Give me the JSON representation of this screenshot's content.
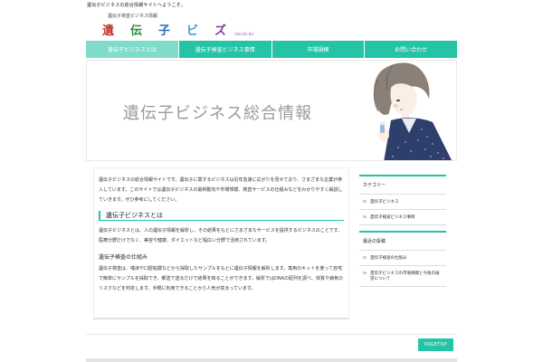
{
  "header": {
    "topline": "遺伝子ビジネスの総合情報サイトへようこそ。",
    "logo": {
      "tagline": "遺伝子検査ビジネス情報",
      "chars": [
        "遺",
        "伝",
        "子",
        "ビ",
        "ズ"
      ],
      "char_colors": [
        "#c0392b",
        "#2f8a3a",
        "#2c6fb0",
        "#3a9bd8",
        "#7b3fa0"
      ],
      "url": "idenshi.biz"
    }
  },
  "nav": {
    "items": [
      {
        "label": "遺伝子ビジネスとは"
      },
      {
        "label": "遺伝子検査ビジネス事情"
      },
      {
        "label": "市場規模"
      },
      {
        "label": "お問い合わせ"
      }
    ]
  },
  "hero": {
    "title": "遺伝子ビジネス総合情報"
  },
  "main": {
    "intro": "遺伝子ビジネスの総合情報サイトです。遺伝子に関するビジネスは近年急速に広がりを見せており、さまざまな企業が参入しています。このサイトでは遺伝子ビジネスの最新動向や市場規模、検査サービスの仕組みなどをわかりやすく解説していきます。ぜひ参考にしてください。",
    "h2": "遺伝子ビジネスとは",
    "para2": "遺伝子ビジネスとは、人の遺伝子情報を解析し、その結果をもとにさまざまなサービスを提供するビジネスのことです。医療分野だけでなく、美容や健康、ダイエットなど幅広い分野で活用されています。",
    "h3": "遺伝子検査の仕組み",
    "para3": "遺伝子検査は、唾液や口腔粘膜などから採取したサンプルをもとに遺伝子情報を解析します。専用のキットを使って自宅で簡単にサンプルを採取でき、郵送で送るだけで結果を知ることができます。解析ではDNAの配列を調べ、体質や病気のリスクなどを判定します。手軽に利用できることから人気が高まっています。"
  },
  "sidebar": {
    "widgets": [
      {
        "title": "カテゴリー",
        "items": [
          "遺伝子ビジネス",
          "遺伝子検査ビジネス事情"
        ]
      },
      {
        "title": "最近の投稿",
        "items": [
          "遺伝子検査の仕組み",
          "遺伝子ビジネスの市場規模と今後の展望について"
        ]
      }
    ]
  },
  "footer": {
    "pagetop": "PAGETOP"
  },
  "colors": {
    "accent": "#25c4a6",
    "accent_light": "#7fdccb"
  }
}
